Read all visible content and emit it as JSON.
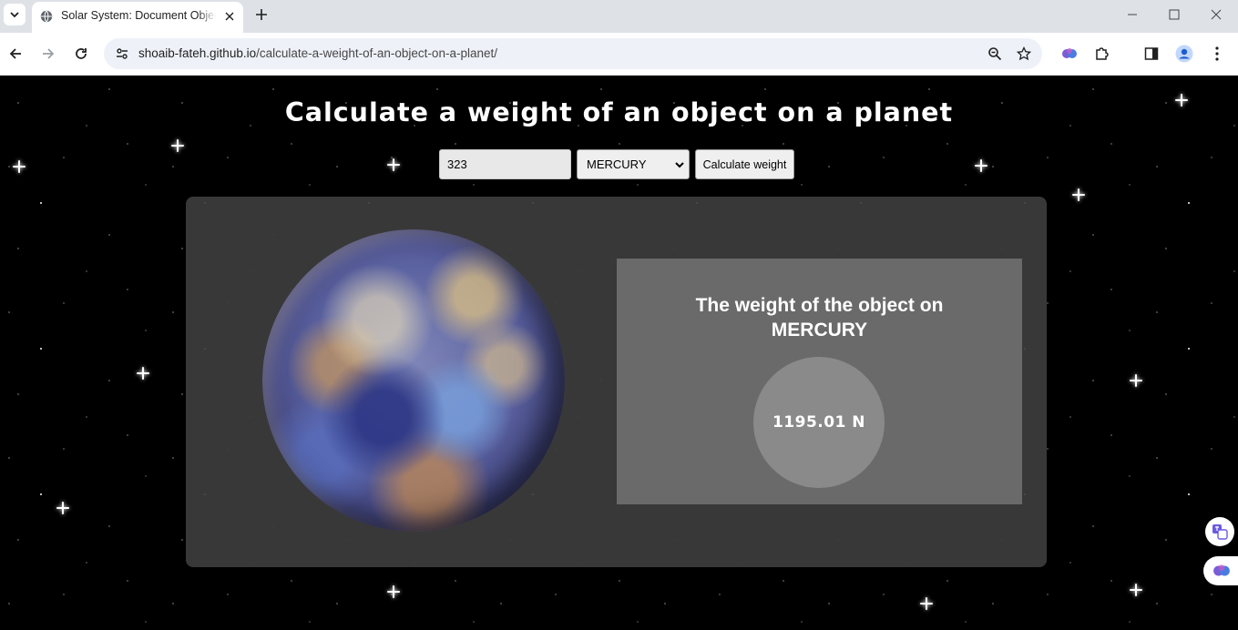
{
  "browser": {
    "tab_title": "Solar System: Document Object",
    "url_host": "shoaib-fateh.github.io",
    "url_path": "/calculate-a-weight-of-an-object-on-a-planet/"
  },
  "page": {
    "heading": "Calculate a weight of an object on a planet",
    "mass_input_value": "323",
    "planet_select_value": "MERCURY",
    "calculate_button_label": "Calculate weight",
    "result_title_line1": "The weight of the object on",
    "result_planet": "MERCURY",
    "result_value": "1195.01 N"
  },
  "colors": {
    "accent_blue": "#1a73e8",
    "page_background": "#000000",
    "panel_background": "#3c3c3c"
  },
  "icons": [
    "tab-search-icon",
    "globe-icon",
    "close-icon",
    "plus-icon",
    "minimize-icon",
    "maximize-icon",
    "back-icon",
    "forward-icon",
    "reload-icon",
    "site-info-icon",
    "zoom-icon",
    "star-icon",
    "extension-brain-icon",
    "puzzle-icon",
    "sidepanel-icon",
    "profile-icon",
    "menu-icon",
    "translate-icon"
  ]
}
